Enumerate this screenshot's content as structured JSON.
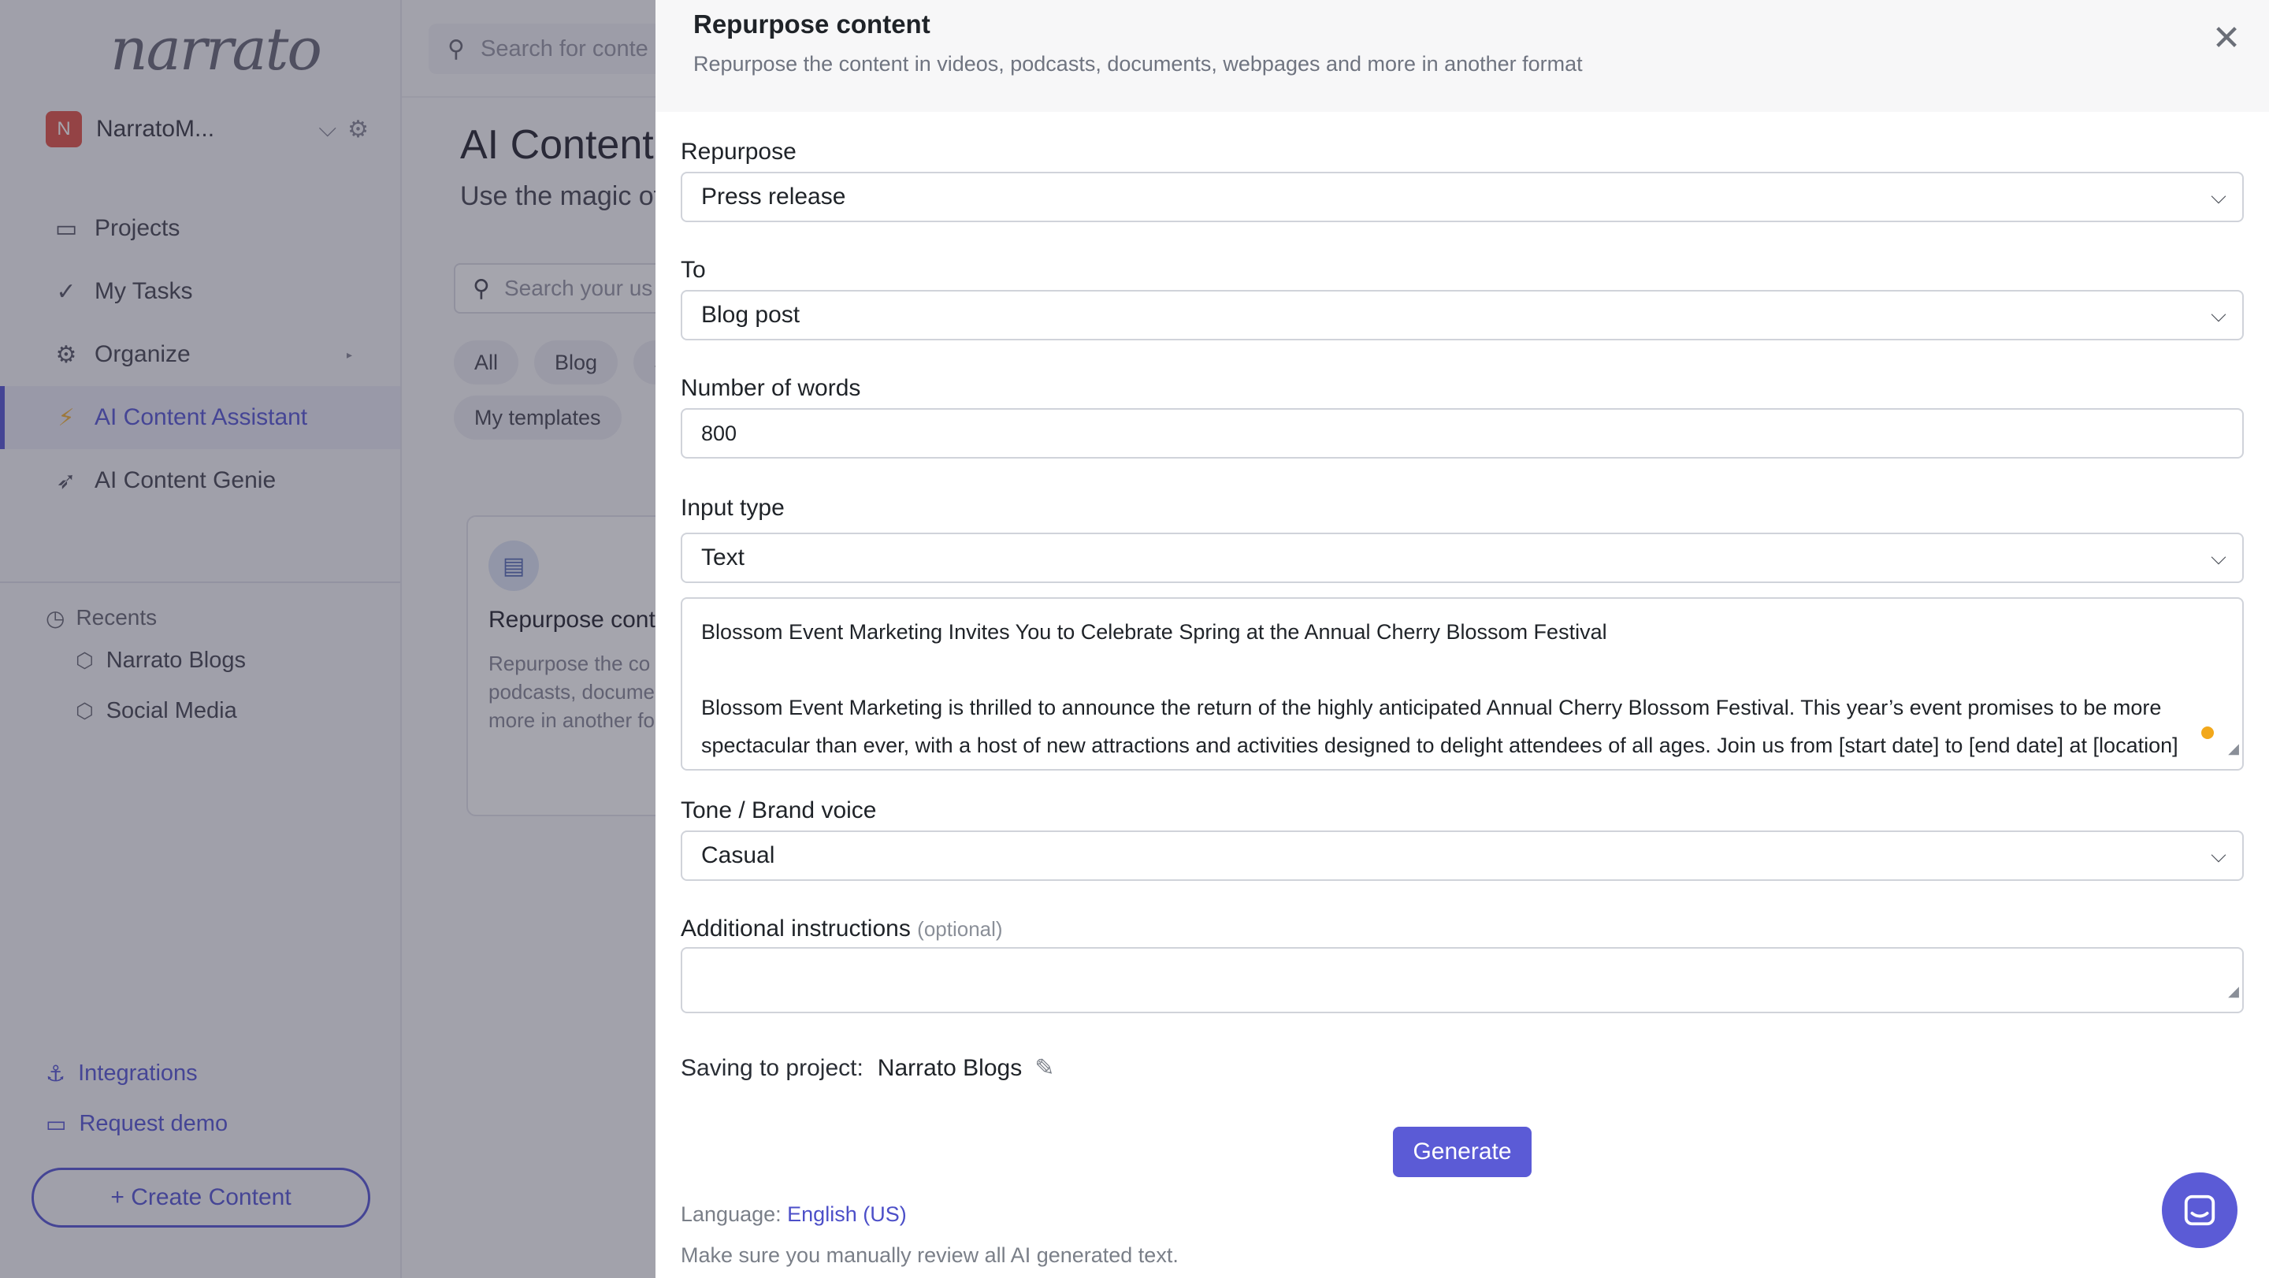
{
  "app": {
    "logo": "narrato",
    "workspace": {
      "initial": "N",
      "name": "NarratoM..."
    },
    "nav": [
      {
        "label": "Projects",
        "icon": "briefcase-icon"
      },
      {
        "label": "My Tasks",
        "icon": "check-icon"
      },
      {
        "label": "Organize",
        "icon": "organize-icon"
      },
      {
        "label": "AI Content Assistant",
        "icon": "lightning-icon",
        "active": true
      },
      {
        "label": "AI Content Genie",
        "icon": "rocket-icon"
      }
    ],
    "recents": {
      "title": "Recents",
      "items": [
        {
          "label": "Narrato Blogs"
        },
        {
          "label": "Social Media"
        }
      ]
    },
    "bottom_links": [
      {
        "label": "Integrations",
        "icon": "anchor-icon"
      },
      {
        "label": "Request demo",
        "icon": "monitor-icon"
      }
    ],
    "create_button": "+ Create Content",
    "top_search_placeholder": "Search for conte",
    "main": {
      "title": "AI Content",
      "subtitle": "Use the magic of",
      "search_placeholder": "Search your us",
      "chips": [
        "All",
        "Blog",
        "S"
      ],
      "chip_my": "My templates",
      "card": {
        "title": "Repurpose cont",
        "desc_lines": [
          "Repurpose the co",
          "podcasts, docume",
          "more in another fo"
        ]
      }
    }
  },
  "drawer": {
    "title": "Repurpose content",
    "subtitle": "Repurpose the content in videos, podcasts, documents, webpages and more in another format",
    "fields": {
      "repurpose": {
        "label": "Repurpose",
        "value": "Press release"
      },
      "to": {
        "label": "To",
        "value": "Blog post"
      },
      "words": {
        "label": "Number of words",
        "value": "800"
      },
      "input_type": {
        "label": "Input type",
        "value": "Text"
      },
      "input_text": {
        "lines": [
          "Blossom Event Marketing Invites You to Celebrate Spring at the Annual Cherry Blossom Festival",
          "",
          "Blossom Event Marketing is thrilled to announce the return of the highly anticipated Annual Cherry Blossom Festival. This year’s event promises to be more",
          "spectacular than ever, with a host of new attractions and activities designed to delight attendees of all ages. Join us from [start date] to [end date] at [location]"
        ]
      },
      "tone": {
        "label": "Tone / Brand voice",
        "value": "Casual"
      },
      "additional": {
        "label": "Additional instructions",
        "optional": "(optional)",
        "value": ""
      }
    },
    "saving": {
      "label": "Saving to project:",
      "project": "Narrato Blogs"
    },
    "generate": "Generate",
    "language": {
      "label": "Language:",
      "value": "English (US)"
    },
    "review_note": "Make sure you manually review all AI generated text."
  },
  "colors": {
    "accent": "#5b5bd6",
    "warning": "#f2a81b"
  }
}
